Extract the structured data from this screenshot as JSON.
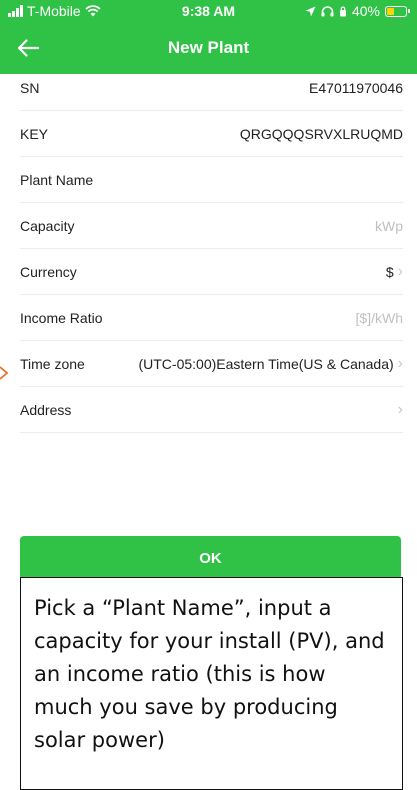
{
  "status_bar": {
    "carrier": "T-Mobile",
    "time": "9:38 AM",
    "battery_percent": "40%",
    "battery_level": 0.4,
    "battery_color": "#ffd400"
  },
  "nav": {
    "title": "New Plant",
    "back_icon": "arrow-left-icon",
    "bar_color": "#2fc246"
  },
  "form": {
    "rows": [
      {
        "label": "SN",
        "value": "E47011970046"
      },
      {
        "label": "KEY",
        "value": "QRGQQQSRVXLRUQMD"
      },
      {
        "label": "Plant Name",
        "value": ""
      },
      {
        "label": "Capacity",
        "placeholder": "kWp"
      },
      {
        "label": "Currency",
        "value": "$"
      },
      {
        "label": "Income Ratio",
        "placeholder": "[$]/kWh"
      },
      {
        "label": "Time zone",
        "value": "(UTC-05:00)Eastern Time(US & Canada)"
      },
      {
        "label": "Address",
        "value": ""
      }
    ]
  },
  "ok_button": {
    "label": "OK"
  },
  "annotation": {
    "text": "Pick a “Plant Name”, input a capacity for your install (PV), and an income ratio (this is how much you save by producing solar power)"
  }
}
